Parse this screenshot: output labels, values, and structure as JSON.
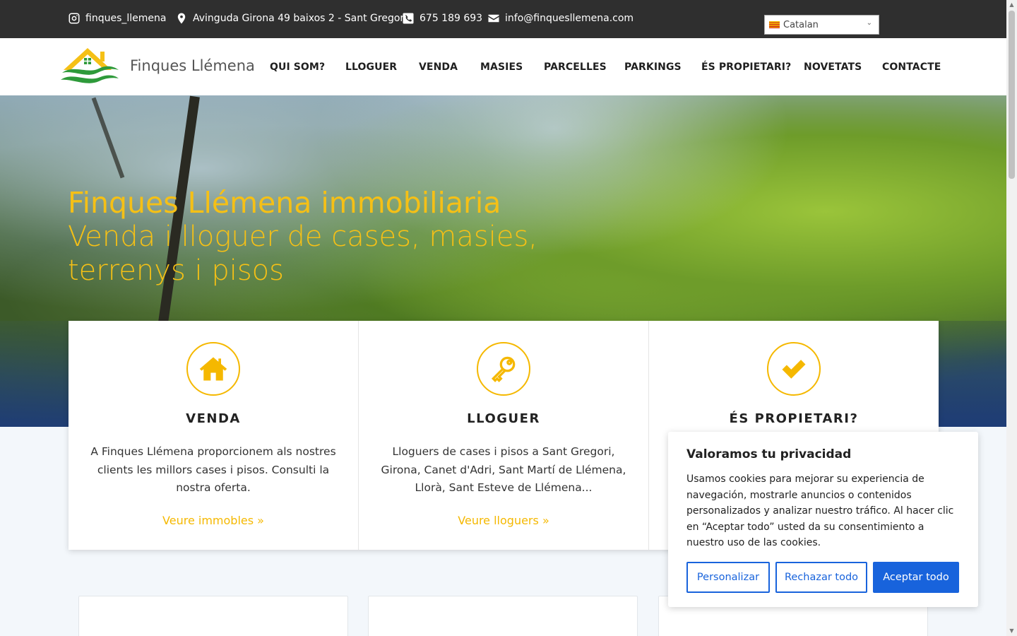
{
  "topbar": {
    "instagram": "finques_llemena",
    "address": "Avinguda Girona 49 baixos 2 - Sant Gregori",
    "phone": "675 189 693",
    "email": "info@finquesllemena.com",
    "language": "Catalan"
  },
  "header": {
    "brand": "Finques Llémena",
    "nav": [
      "QUI SOM?",
      "LLOGUER",
      "VENDA",
      "MASIES",
      "PARCELLES",
      "PARKINGS",
      "ÉS PROPIETARI?",
      "NOVETATS",
      "CONTACTE"
    ]
  },
  "hero": {
    "title": "Finques Llémena immobiliaria",
    "subtitle": "Venda i lloguer de cases, masies, terrenys i pisos"
  },
  "services": [
    {
      "icon": "house-icon",
      "title": "VENDA",
      "text": "A Finques Llémena proporcionem als nostres clients les millors cases i pisos. Consulti la nostra oferta.",
      "link": "Veure immobles"
    },
    {
      "icon": "key-icon",
      "title": "LLOGUER",
      "text": "Lloguers de cases i pisos a Sant Gregori, Girona, Canet d'Adri, Sant Martí de Llémena, Llorà, Sant Esteve de Llémena...",
      "link": "Veure lloguers"
    },
    {
      "icon": "check-icon",
      "title": "ÉS PROPIETARI?",
      "text": "",
      "link": ""
    }
  ],
  "cookie": {
    "title": "Valoramos tu privacidad",
    "text": "Usamos cookies para mejorar su experiencia de navegación, mostrarle anuncios o contenidos personalizados y analizar nuestro tráfico. Al hacer clic en “Aceptar todo” usted da su consentimiento a nuestro uso de las cookies.",
    "customize": "Personalizar",
    "reject": "Rechazar todo",
    "accept": "Aceptar todo"
  },
  "colors": {
    "accent": "#f5b800",
    "topbar": "#2f2f2f",
    "cookie_primary": "#1863dc"
  }
}
